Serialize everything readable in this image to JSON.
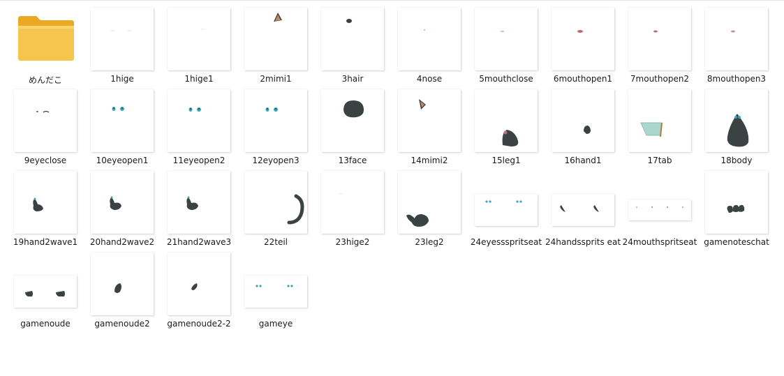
{
  "items": [
    {
      "label": "めんだこ",
      "icon": "folder-icon"
    },
    {
      "label": "1hige",
      "icon": "image-thumbnail-icon"
    },
    {
      "label": "1hige1",
      "icon": "image-thumbnail-icon"
    },
    {
      "label": "2mimi1",
      "icon": "image-thumbnail-icon"
    },
    {
      "label": "3hair",
      "icon": "image-thumbnail-icon"
    },
    {
      "label": "4nose",
      "icon": "image-thumbnail-icon"
    },
    {
      "label": "5mouthclose",
      "icon": "image-thumbnail-icon"
    },
    {
      "label": "6mouthopen1",
      "icon": "image-thumbnail-icon"
    },
    {
      "label": "7mouthopen2",
      "icon": "image-thumbnail-icon"
    },
    {
      "label": "8mouthopen3",
      "icon": "image-thumbnail-icon"
    },
    {
      "label": "9eyeclose",
      "icon": "image-thumbnail-icon"
    },
    {
      "label": "10eyeopen1",
      "icon": "image-thumbnail-icon"
    },
    {
      "label": "11eyeopen2",
      "icon": "image-thumbnail-icon"
    },
    {
      "label": "12eyopen3",
      "icon": "image-thumbnail-icon"
    },
    {
      "label": "13face",
      "icon": "image-thumbnail-icon"
    },
    {
      "label": "14mimi2",
      "icon": "image-thumbnail-icon"
    },
    {
      "label": "15leg1",
      "icon": "image-thumbnail-icon"
    },
    {
      "label": "16hand1",
      "icon": "image-thumbnail-icon"
    },
    {
      "label": "17tab",
      "icon": "image-thumbnail-icon"
    },
    {
      "label": "18body",
      "icon": "image-thumbnail-icon"
    },
    {
      "label": "19hand2wave1",
      "icon": "image-thumbnail-icon"
    },
    {
      "label": "20hand2wave2",
      "icon": "image-thumbnail-icon"
    },
    {
      "label": "21hand2wave3",
      "icon": "image-thumbnail-icon"
    },
    {
      "label": "22teil",
      "icon": "image-thumbnail-icon"
    },
    {
      "label": "23hige2",
      "icon": "image-thumbnail-icon"
    },
    {
      "label": "23leg2",
      "icon": "image-thumbnail-icon"
    },
    {
      "label": "24eyessspritseat",
      "icon": "image-thumbnail-icon"
    },
    {
      "label": "24handssprits eat",
      "icon": "image-thumbnail-icon"
    },
    {
      "label": "24mouthspritseat",
      "icon": "image-thumbnail-icon"
    },
    {
      "label": "gamenoteschat",
      "icon": "image-thumbnail-icon"
    },
    {
      "label": "gamenoude",
      "icon": "image-thumbnail-icon"
    },
    {
      "label": "gamenoude2",
      "icon": "image-thumbnail-icon"
    },
    {
      "label": "gamenoude2-2",
      "icon": "image-thumbnail-icon"
    },
    {
      "label": "gameye",
      "icon": "image-thumbnail-icon"
    }
  ],
  "colors": {
    "dark": "#3a4242",
    "eye": "#3aa7b8",
    "folder": "#f6c54c",
    "folder_dark": "#e9a923"
  }
}
